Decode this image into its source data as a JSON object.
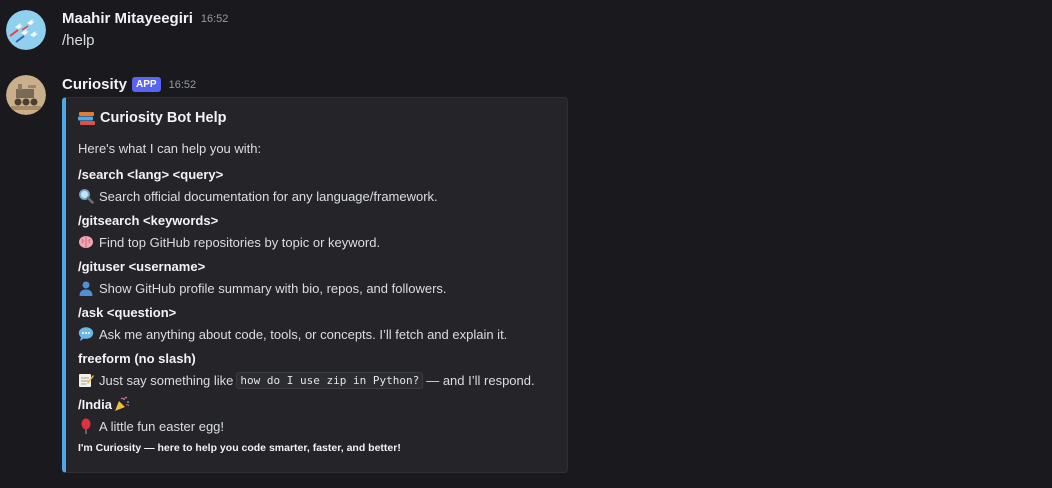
{
  "messages": [
    {
      "username": "Maahir Mitayeegiri",
      "timestamp": "16:52",
      "content": "/help",
      "avatar_icon": "fighter-jets-avatar-icon"
    },
    {
      "username": "Curiosity",
      "badge": "APP",
      "timestamp": "16:52",
      "avatar_icon": "mars-rover-avatar-icon",
      "embed": {
        "accent_color": "#4fa8e8",
        "title": "Curiosity Bot Help",
        "title_icon": "books-icon",
        "intro": "Here's what I can help you with:",
        "commands": [
          {
            "name": "/search <lang> <query>",
            "icon": "magnifier-icon",
            "description": "Search official documentation for any language/framework."
          },
          {
            "name": "/gitsearch <keywords>",
            "icon": "brain-icon",
            "description": "Find top GitHub repositories by topic or keyword."
          },
          {
            "name": "/gituser <username>",
            "icon": "user-silhouette-icon",
            "description": "Show GitHub profile summary with bio, repos, and followers."
          },
          {
            "name": "/ask <question>",
            "icon": "speech-bubble-icon",
            "description": "Ask me anything about code, tools, or concepts. I’ll fetch and explain it."
          },
          {
            "name": "freeform (no slash)",
            "icon": "memo-icon",
            "description_before": "Just say something like",
            "description_code": "how do I use zip in Python?",
            "description_after": "— and I’ll respond."
          },
          {
            "name": "/India",
            "name_icon": "party-popper-icon",
            "icon": "balloon-icon",
            "description": "A little fun easter egg!"
          }
        ],
        "footer": "I'm Curiosity — here to help you code smarter, faster, and better!"
      }
    }
  ]
}
